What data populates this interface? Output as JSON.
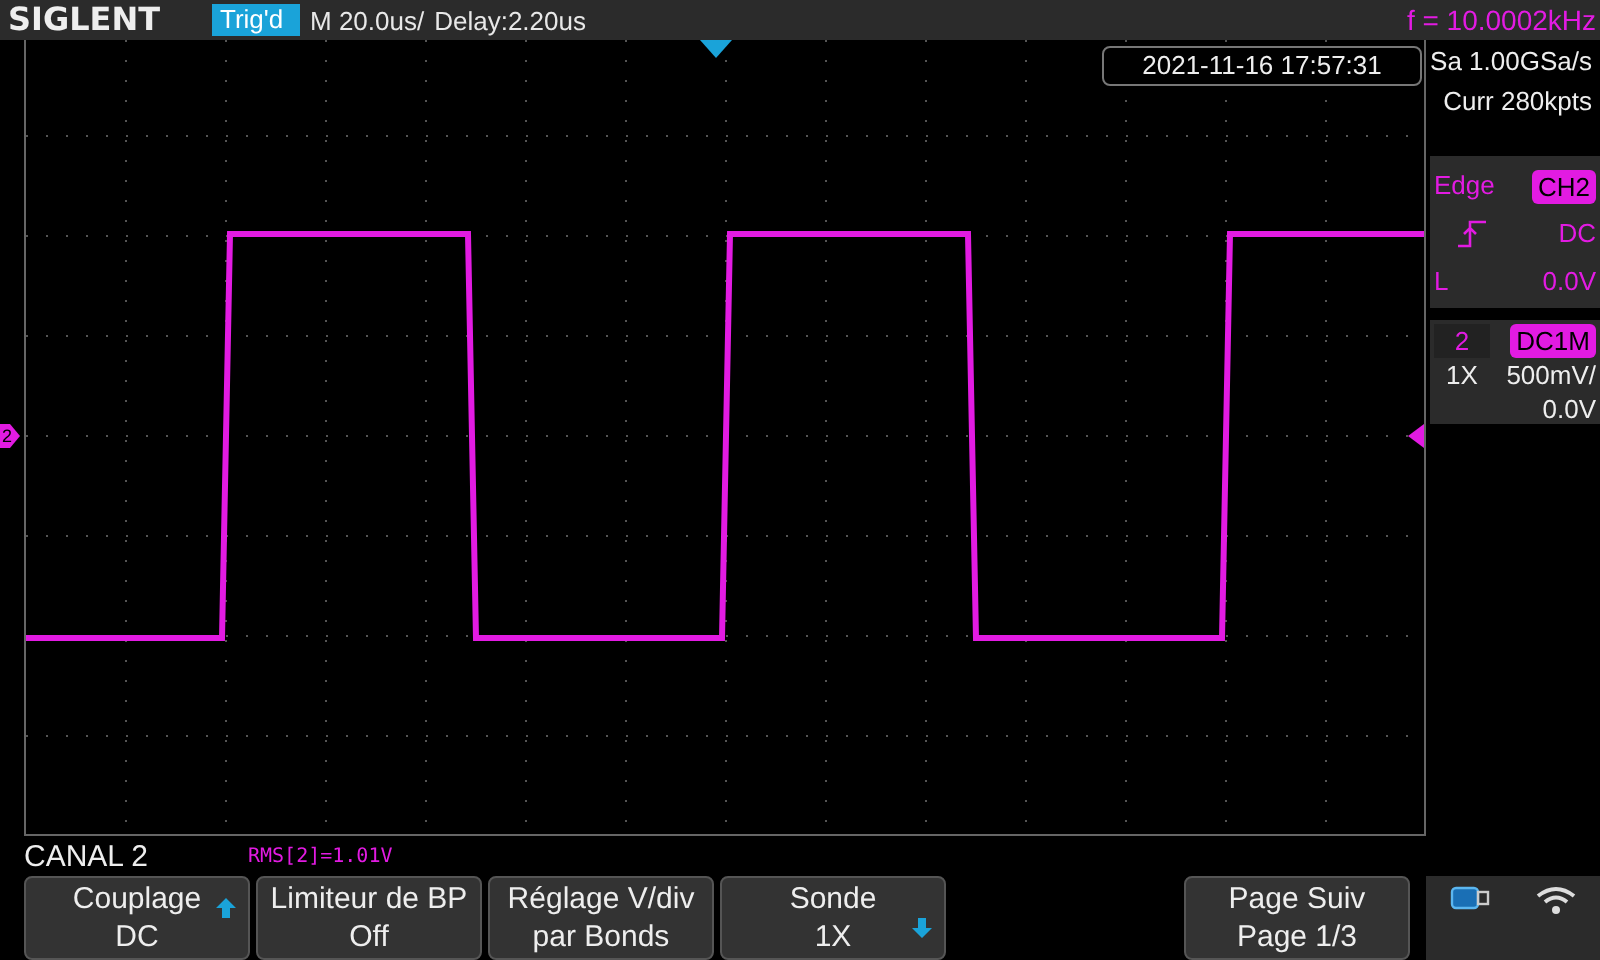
{
  "header": {
    "brand": "SIGLENT",
    "trigger_status": "Trig'd",
    "timebase": "M 20.0us/",
    "delay": "Delay:2.20us",
    "frequency": "f = 10.0002kHz"
  },
  "datetime": "2021-11-16 17:57:31",
  "channel_marker": "2",
  "acquisition": {
    "sample_rate": "Sa 1.00GSa/s",
    "memory_depth": "Curr 280kpts"
  },
  "trigger": {
    "type": "Edge",
    "source": "CH2",
    "coupling": "DC",
    "level_label": "L",
    "level": "0.0V"
  },
  "channel": {
    "number": "2",
    "coupling": "DC1M",
    "probe": "1X",
    "scale": "500mV/",
    "offset": "0.0V"
  },
  "menu_title": "CANAL 2",
  "measurement": "RMS[2]=1.01V",
  "softkeys": [
    {
      "title": "Couplage",
      "value": "DC",
      "up_arrow": true,
      "down_arrow": false
    },
    {
      "title": "Limiteur de BP",
      "value": "Off",
      "up_arrow": false,
      "down_arrow": false
    },
    {
      "title": "Réglage V/div",
      "value": "par Bonds",
      "up_arrow": false,
      "down_arrow": false
    },
    {
      "title": "Sonde",
      "value": "1X",
      "up_arrow": false,
      "down_arrow": true
    }
  ],
  "page_button": {
    "title": "Page Suiv",
    "value": "Page 1/3"
  }
}
